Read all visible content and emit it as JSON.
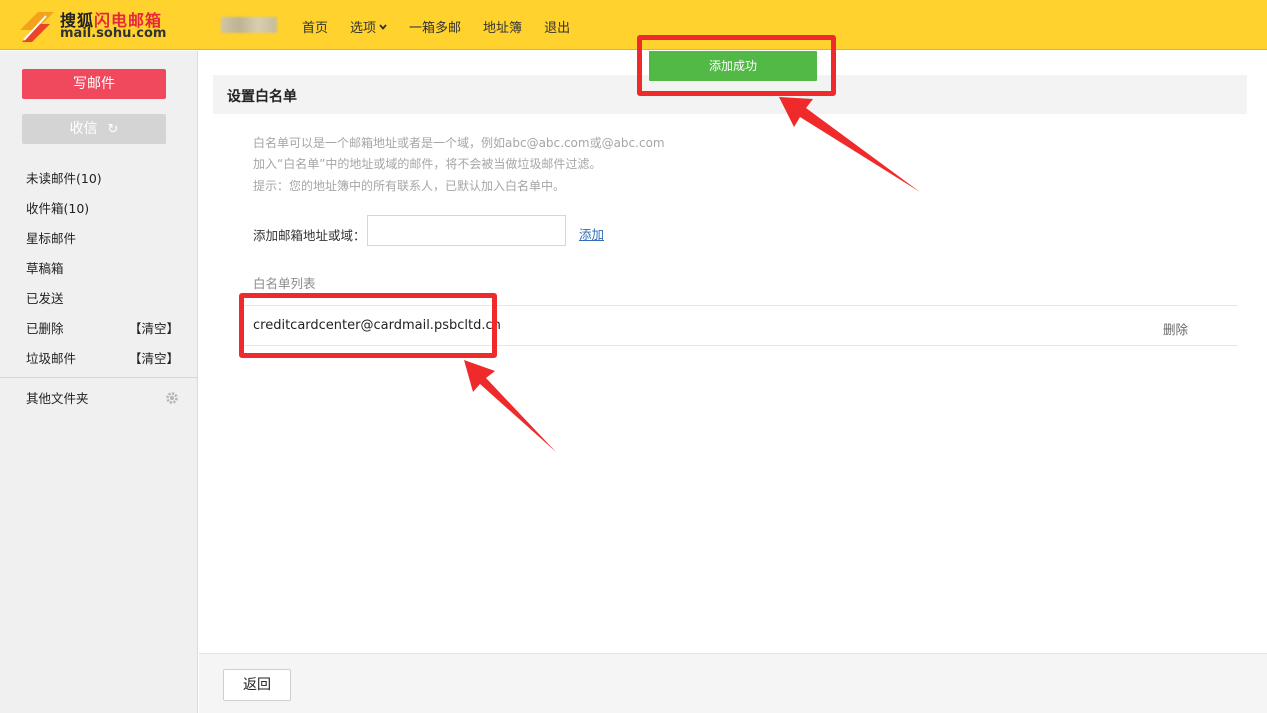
{
  "header": {
    "logo_text_black": "搜狐",
    "logo_text_red": "闪电邮箱",
    "logo_domain": "mail.sohu.com",
    "nav": [
      "首页",
      "选项",
      "一箱多邮",
      "地址簿",
      "退出"
    ]
  },
  "sidebar": {
    "compose_label": "写邮件",
    "receive_label": "收信",
    "folders": [
      {
        "label": "未读邮件(10)",
        "action": ""
      },
      {
        "label": "收件箱(10)",
        "action": ""
      },
      {
        "label": "星标邮件",
        "action": ""
      },
      {
        "label": "草稿箱",
        "action": ""
      },
      {
        "label": "已发送",
        "action": ""
      },
      {
        "label": "已删除",
        "action": "【清空】"
      },
      {
        "label": "垃圾邮件",
        "action": "【清空】"
      }
    ],
    "other_folders_label": "其他文件夹"
  },
  "main": {
    "toast": "添加成功",
    "section_title": "设置白名单",
    "hints": [
      "白名单可以是一个邮箱地址或者是一个域，例如abc@abc.com或@abc.com",
      "加入“白名单”中的地址或域的邮件，将不会被当做垃圾邮件过滤。",
      "提示：您的地址簿中的所有联系人，已默认加入白名单中。"
    ],
    "add_label": "添加邮箱地址或域：",
    "add_input_value": "",
    "add_link": "添加",
    "list_title": "白名单列表",
    "whitelist": [
      {
        "email": "creditcardcenter@cardmail.psbcltd.cn",
        "delete_label": "删除"
      }
    ]
  },
  "footer": {
    "back_label": "返回"
  },
  "colors": {
    "header_bg": "#ffd22e",
    "compose_bg": "#f0495d",
    "toast_bg": "#53b946",
    "annotation": "#ee2a2a",
    "link": "#2f6eb6"
  }
}
